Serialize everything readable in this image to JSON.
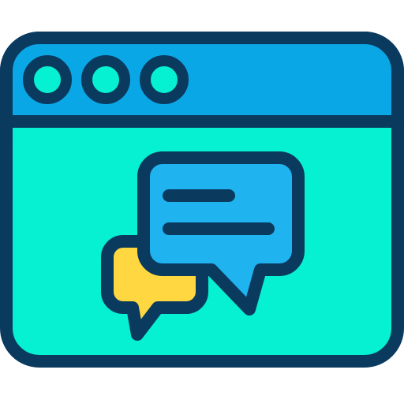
{
  "icon": {
    "name": "browser-chat-icon",
    "colors": {
      "outline": "#0b3a5f",
      "title_bar": "#0aa7e6",
      "window_body": "#06f0d2",
      "traffic_dot": "#06f0d2",
      "chat_bubble_front": "#1fb3f0",
      "chat_bubble_back": "#ffd740"
    }
  }
}
